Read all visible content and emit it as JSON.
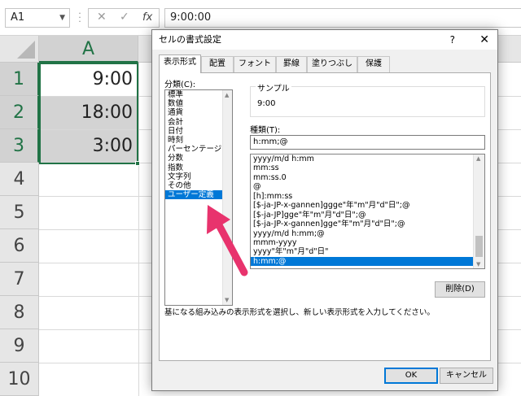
{
  "formula_bar": {
    "name_box": "A1",
    "fx_label": "fx",
    "formula": "9:00:00"
  },
  "sheet": {
    "column_header": "A",
    "row_headers": [
      "1",
      "2",
      "3",
      "4",
      "5",
      "6",
      "7",
      "8",
      "9",
      "10"
    ],
    "cells": [
      "9:00",
      "18:00",
      "3:00"
    ]
  },
  "dialog": {
    "title": "セルの書式設定",
    "help": "?",
    "close": "✕",
    "tabs": [
      "表示形式",
      "配置",
      "フォント",
      "罫線",
      "塗りつぶし",
      "保護"
    ],
    "category_label": "分類(C):",
    "categories": [
      "標準",
      "数値",
      "通貨",
      "会計",
      "日付",
      "時刻",
      "パーセンテージ",
      "分数",
      "指数",
      "文字列",
      "その他",
      "ユーザー定義"
    ],
    "selected_category": "ユーザー定義",
    "sample_label": "サンプル",
    "sample_value": "9:00",
    "type_label": "種類(T):",
    "type_value": "h:mm;@",
    "formats": [
      "yyyy/m/d h:mm",
      "mm:ss",
      "mm:ss.0",
      "@",
      "[h]:mm:ss",
      "[$-ja-JP-x-gannen]ggge\"年\"m\"月\"d\"日\";@",
      "[$-ja-JP]gge\"年\"m\"月\"d\"日\";@",
      "[$-ja-JP-x-gannen]gge\"年\"m\"月\"d\"日\";@",
      "yyyy/m/d h:mm;@",
      "mmm-yyyy",
      "yyyy\"年\"m\"月\"d\"日\"",
      "h:mm;@"
    ],
    "selected_format": "h:mm;@",
    "delete_button": "削除(D)",
    "hint": "基になる組み込みの表示形式を選択し、新しい表示形式を入力してください。",
    "ok": "OK",
    "cancel": "キャンセル"
  },
  "colors": {
    "excel_green": "#217346",
    "selection_blue": "#0078d7",
    "arrow_pink": "#e8336d"
  }
}
